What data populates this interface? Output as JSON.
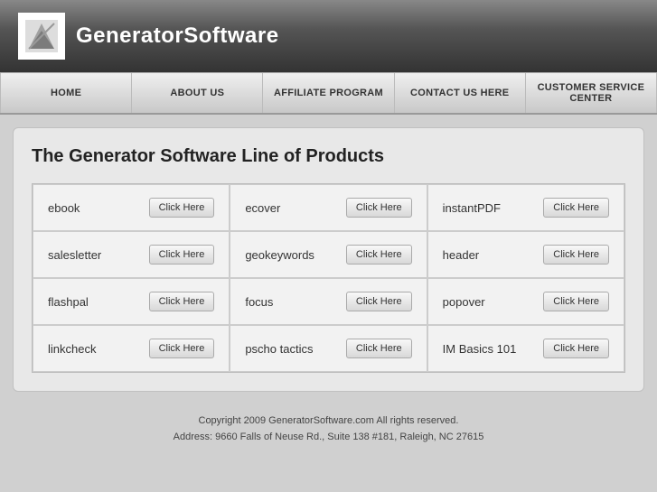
{
  "header": {
    "logo_text": "GeneratorSoftware"
  },
  "nav": {
    "items": [
      {
        "id": "home",
        "label": "HOME"
      },
      {
        "id": "about",
        "label": "ABOUT US"
      },
      {
        "id": "affiliate",
        "label": "AFFILIATE PROGRAM"
      },
      {
        "id": "contact",
        "label": "CONTACT US HERE"
      },
      {
        "id": "customer-service",
        "label": "CUSTOMER SERVICE CENTER"
      }
    ]
  },
  "main": {
    "title": "The Generator Software Line of Products",
    "products": [
      {
        "id": "ebook",
        "name": "ebook",
        "btn": "Click Here"
      },
      {
        "id": "ecover",
        "name": "ecover",
        "btn": "Click Here"
      },
      {
        "id": "instantpdf",
        "name": "instantPDF",
        "btn": "Click Here"
      },
      {
        "id": "salesletter",
        "name": "salesletter",
        "btn": "Click Here"
      },
      {
        "id": "geokeywords",
        "name": "geokeywords",
        "btn": "Click Here"
      },
      {
        "id": "header",
        "name": "header",
        "btn": "Click Here"
      },
      {
        "id": "flashpal",
        "name": "flashpal",
        "btn": "Click Here"
      },
      {
        "id": "focus",
        "name": "focus",
        "btn": "Click Here"
      },
      {
        "id": "popover",
        "name": "popover",
        "btn": "Click Here"
      },
      {
        "id": "linkcheck",
        "name": "linkcheck",
        "btn": "Click Here"
      },
      {
        "id": "pscho-tactics",
        "name": "pscho tactics",
        "btn": "Click Here"
      },
      {
        "id": "im-basics-101",
        "name": "IM Basics 101",
        "btn": "Click Here"
      }
    ]
  },
  "footer": {
    "line1": "Copyright 2009 GeneratorSoftware.com All rights reserved.",
    "line2": "Address: 9660 Falls of Neuse Rd., Suite 138 #181, Raleigh, NC 27615"
  }
}
